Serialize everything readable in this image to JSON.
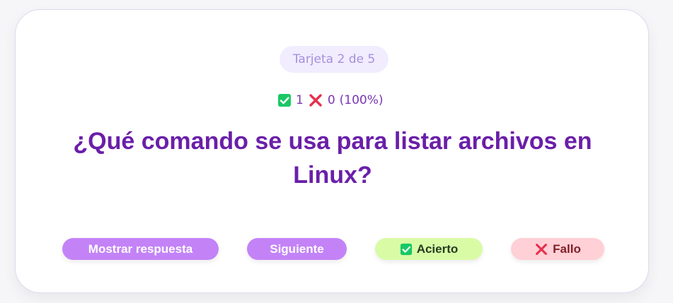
{
  "card": {
    "progress_label": "Tarjeta 2 de 5",
    "score": {
      "correct_count": "1",
      "wrong_count": "0",
      "percentage_text": "(100%)"
    },
    "question": "¿Qué comando se usa para listar archivos en Linux?"
  },
  "actions": {
    "show_answer_label": "Mostrar respuesta",
    "next_label": "Siguiente",
    "correct_label": "Acierto",
    "fail_label": "Fallo"
  },
  "icons": {
    "correct": "green-checkbox-check-icon",
    "wrong": "red-cross-icon"
  },
  "colors": {
    "accent_purple": "#6a1fa8",
    "button_purple": "#c383f7",
    "correct_green": "#d9fba6",
    "fail_pink": "#ffd0d6",
    "check_green": "#19c865",
    "cross_red": "#e5304e"
  }
}
